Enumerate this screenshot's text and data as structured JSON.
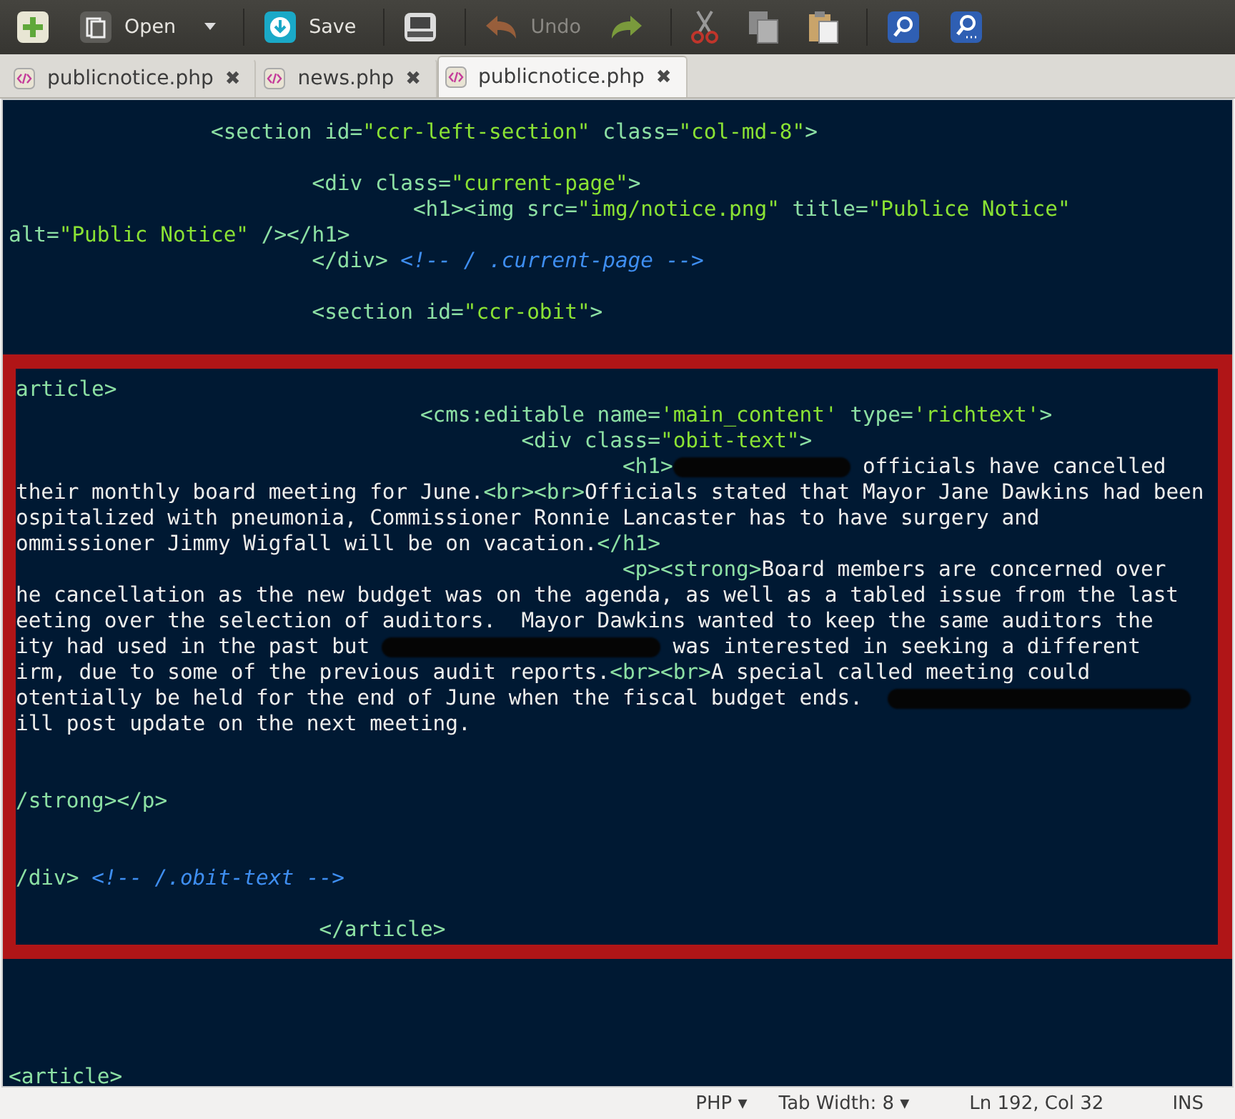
{
  "toolbar": {
    "items": [
      {
        "kind": "new",
        "disabled": false
      },
      {
        "kind": "open",
        "label": "Open",
        "disabled": false
      },
      {
        "kind": "dropdown",
        "disabled": false
      },
      {
        "kind": "save",
        "label": "Save",
        "disabled": false
      },
      {
        "kind": "print",
        "disabled": false
      },
      {
        "kind": "undo",
        "label": "Undo",
        "disabled": true
      },
      {
        "kind": "redo",
        "disabled": false
      },
      {
        "kind": "cut",
        "disabled": false
      },
      {
        "kind": "copy",
        "disabled": false
      },
      {
        "kind": "paste",
        "disabled": false
      },
      {
        "kind": "find",
        "disabled": false
      },
      {
        "kind": "replace",
        "disabled": false
      }
    ]
  },
  "tabs": [
    {
      "label": "publicnotice.php",
      "close": "✖",
      "selected": false
    },
    {
      "label": "news.php",
      "close": "✖",
      "selected": false
    },
    {
      "label": "publicnotice.php",
      "close": "✖",
      "selected": true
    }
  ],
  "editor": {
    "lines": [
      {
        "kind": "code",
        "segments": [
          {
            "kind": "tab"
          },
          {
            "kind": "tab"
          },
          {
            "kind": "tag",
            "text": "<section id="
          },
          {
            "kind": "string",
            "text": "\"ccr-left-section\""
          },
          {
            "kind": "tag",
            "text": " class="
          },
          {
            "kind": "string",
            "text": "\"col-md-8\""
          },
          {
            "kind": "tag",
            "text": ">"
          }
        ]
      },
      {
        "kind": "blank"
      },
      {
        "kind": "code",
        "segments": [
          {
            "kind": "tab"
          },
          {
            "kind": "tab"
          },
          {
            "kind": "tab"
          },
          {
            "kind": "tag",
            "text": "<div class="
          },
          {
            "kind": "string",
            "text": "\"current-page\""
          },
          {
            "kind": "tag",
            "text": ">"
          }
        ]
      },
      {
        "kind": "code",
        "segments": [
          {
            "kind": "tab"
          },
          {
            "kind": "tab"
          },
          {
            "kind": "tab"
          },
          {
            "kind": "tab"
          },
          {
            "kind": "tag",
            "text": "<h1><img src="
          },
          {
            "kind": "string",
            "text": "\"img/notice.png\""
          },
          {
            "kind": "tag",
            "text": " title="
          },
          {
            "kind": "string",
            "text": "\"Publice Notice\""
          }
        ]
      },
      {
        "kind": "code",
        "segments": [
          {
            "kind": "tag",
            "text": "alt="
          },
          {
            "kind": "string",
            "text": "\"Public Notice\""
          },
          {
            "kind": "tag",
            "text": " /></h1>"
          }
        ]
      },
      {
        "kind": "code",
        "segments": [
          {
            "kind": "tab"
          },
          {
            "kind": "tab"
          },
          {
            "kind": "tab"
          },
          {
            "kind": "tag",
            "text": "</div>"
          },
          {
            "kind": "space"
          },
          {
            "kind": "comment",
            "text": "<!-- / .current-page -->"
          }
        ]
      },
      {
        "kind": "blank"
      },
      {
        "kind": "code",
        "segments": [
          {
            "kind": "tab"
          },
          {
            "kind": "tab"
          },
          {
            "kind": "tab"
          },
          {
            "kind": "tag",
            "text": "<section id="
          },
          {
            "kind": "string",
            "text": "\"ccr-obit\""
          },
          {
            "kind": "tag",
            "text": ">"
          }
        ]
      },
      {
        "kind": "blank"
      }
    ],
    "highlighted_lines": [
      {
        "kind": "code",
        "segments": [
          {
            "kind": "tag",
            "text": "article>"
          }
        ]
      },
      {
        "kind": "code",
        "segments": [
          {
            "kind": "tab"
          },
          {
            "kind": "tab"
          },
          {
            "kind": "tab"
          },
          {
            "kind": "tab"
          },
          {
            "kind": "tag",
            "text": "<cms:editable name="
          },
          {
            "kind": "string",
            "text": "'main_content'"
          },
          {
            "kind": "tag",
            "text": " type="
          },
          {
            "kind": "string",
            "text": "'richtext'"
          },
          {
            "kind": "tag",
            "text": ">"
          }
        ]
      },
      {
        "kind": "code",
        "segments": [
          {
            "kind": "tab"
          },
          {
            "kind": "tab"
          },
          {
            "kind": "tab"
          },
          {
            "kind": "tab"
          },
          {
            "kind": "tab"
          },
          {
            "kind": "tag",
            "text": "<div class="
          },
          {
            "kind": "string",
            "text": "\"obit-text\""
          },
          {
            "kind": "tag",
            "text": ">"
          }
        ]
      },
      {
        "kind": "code",
        "segments": [
          {
            "kind": "tab"
          },
          {
            "kind": "tab"
          },
          {
            "kind": "tab"
          },
          {
            "kind": "tab"
          },
          {
            "kind": "tab"
          },
          {
            "kind": "tab"
          },
          {
            "kind": "tag",
            "text": "<h1>"
          },
          {
            "kind": "redacted"
          },
          {
            "kind": "text",
            "text": " officials have cancelled"
          }
        ]
      },
      {
        "kind": "code",
        "segments": [
          {
            "kind": "text",
            "text": "their monthly board meeting for June."
          },
          {
            "kind": "tag",
            "text": "<br><br>"
          },
          {
            "kind": "text",
            "text": "Officials stated that Mayor Jane Dawkins had been"
          }
        ]
      },
      {
        "kind": "code",
        "segments": [
          {
            "kind": "text",
            "text": "ospitalized with pneumonia, Commissioner Ronnie Lancaster has to have surgery and"
          }
        ]
      },
      {
        "kind": "code",
        "segments": [
          {
            "kind": "text",
            "text": "ommissioner Jimmy Wigfall will be on vacation."
          },
          {
            "kind": "tag",
            "text": "</h1>"
          }
        ]
      },
      {
        "kind": "code",
        "segments": [
          {
            "kind": "tab"
          },
          {
            "kind": "tab"
          },
          {
            "kind": "tab"
          },
          {
            "kind": "tab"
          },
          {
            "kind": "tab"
          },
          {
            "kind": "tab"
          },
          {
            "kind": "tag",
            "text": "<p><strong>"
          },
          {
            "kind": "text",
            "text": "Board members are concerned over"
          }
        ]
      },
      {
        "kind": "code",
        "segments": [
          {
            "kind": "text",
            "text": "he cancellation as the new budget was on the agenda, as well as a tabled issue from the last"
          }
        ]
      },
      {
        "kind": "code",
        "segments": [
          {
            "kind": "text",
            "text": "eeting over the selection of auditors.  Mayor Dawkins wanted to keep the same auditors the"
          }
        ]
      },
      {
        "kind": "code",
        "segments": [
          {
            "kind": "text",
            "text": "ity had used in the past but "
          },
          {
            "kind": "redacted"
          },
          {
            "kind": "text",
            "text": " was interested in seeking a different"
          }
        ]
      },
      {
        "kind": "code",
        "segments": [
          {
            "kind": "text",
            "text": "irm, due to some of the previous audit reports."
          },
          {
            "kind": "tag",
            "text": "<br><br>"
          },
          {
            "kind": "text",
            "text": "A special called meeting could"
          }
        ]
      },
      {
        "kind": "code",
        "segments": [
          {
            "kind": "text",
            "text": "otentially be held for the end of June when the fiscal budget ends.  "
          },
          {
            "kind": "redacted"
          }
        ]
      },
      {
        "kind": "code",
        "segments": [
          {
            "kind": "text",
            "text": "ill post update on the next meeting."
          }
        ]
      },
      {
        "kind": "blank"
      },
      {
        "kind": "blank"
      },
      {
        "kind": "code",
        "segments": [
          {
            "kind": "tag",
            "text": "/strong></p>"
          }
        ]
      },
      {
        "kind": "blank"
      },
      {
        "kind": "blank"
      },
      {
        "kind": "code",
        "segments": [
          {
            "kind": "tag",
            "text": "/div>"
          },
          {
            "kind": "space"
          },
          {
            "kind": "comment",
            "text": "<!-- /.obit-text -->"
          }
        ]
      },
      {
        "kind": "blank"
      },
      {
        "kind": "code",
        "segments": [
          {
            "kind": "tab"
          },
          {
            "kind": "tab"
          },
          {
            "kind": "tab"
          },
          {
            "kind": "tag",
            "text": "</article>"
          }
        ]
      }
    ],
    "lines_after": [
      {
        "kind": "blank"
      },
      {
        "kind": "blank"
      },
      {
        "kind": "blank"
      },
      {
        "kind": "blank"
      },
      {
        "kind": "code",
        "segments": [
          {
            "kind": "tag",
            "text": "<article>"
          }
        ]
      }
    ]
  },
  "status_bar": {
    "language": "PHP",
    "tab_width": "Tab Width: 8",
    "position": "Ln 192, Col 32",
    "mode": "INS",
    "caret": "▾"
  }
}
